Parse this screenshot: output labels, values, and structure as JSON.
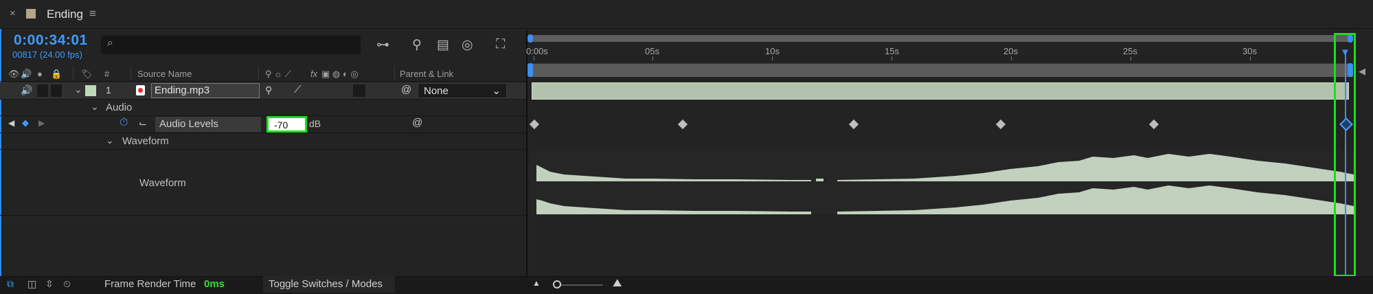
{
  "tab": {
    "close_glyph": "×",
    "title": "Ending",
    "menu_glyph": "≡",
    "swatch_color": "#b3a58a"
  },
  "header": {
    "timecode": "0:00:34:01",
    "frames": "00817 (24.00 fps)",
    "search_placeholder": ""
  },
  "columns": {
    "source_name": "Source Name",
    "number": "#",
    "parent_link": "Parent & Link",
    "fx": "fx"
  },
  "layer": {
    "number": "1",
    "name": "Ending.mp3",
    "parent": "None",
    "label_color": "#bfd8b9"
  },
  "audio_group": {
    "label": "Audio"
  },
  "audio_levels": {
    "label": "Audio Levels",
    "value": "-70",
    "unit": "dB"
  },
  "waveform_group": {
    "label": "Waveform",
    "row_label": "Waveform"
  },
  "bottom": {
    "frame_render_label": "Frame Render Time",
    "frame_render_value": "0ms",
    "toggle_label": "Toggle Switches / Modes"
  },
  "ruler": {
    "ticks": [
      {
        "label": "0:00s"
      },
      {
        "label": "05s"
      },
      {
        "label": "10s"
      },
      {
        "label": "15s"
      },
      {
        "label": "20s"
      },
      {
        "label": "25s"
      },
      {
        "label": "30s"
      }
    ]
  },
  "colors": {
    "accent": "#3e9cff",
    "highlight": "#1ae01a",
    "clip": "#b3c2ad"
  },
  "icons": [
    "close-icon",
    "menu-icon",
    "search-icon",
    "eye-icon",
    "audio-icon",
    "solo-icon",
    "lock-icon",
    "label-icon",
    "stopwatch-icon",
    "graph-icon",
    "pickwhip-icon",
    "keyframe-nav-icon"
  ]
}
